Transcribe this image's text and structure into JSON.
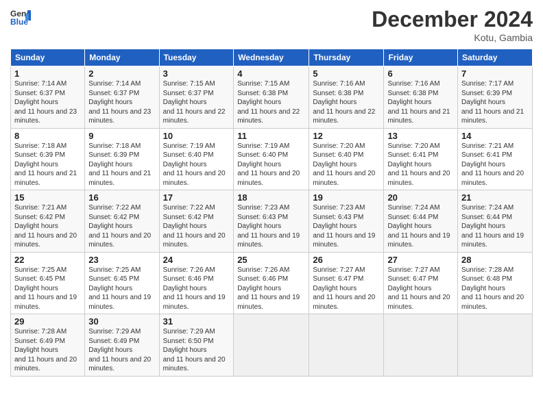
{
  "logo": {
    "general": "General",
    "blue": "Blue"
  },
  "title": "December 2024",
  "location": "Kotu, Gambia",
  "days_of_week": [
    "Sunday",
    "Monday",
    "Tuesday",
    "Wednesday",
    "Thursday",
    "Friday",
    "Saturday"
  ],
  "weeks": [
    [
      {
        "day": 1,
        "sunrise": "7:14 AM",
        "sunset": "6:37 PM",
        "daylight": "11 hours and 23 minutes."
      },
      {
        "day": 2,
        "sunrise": "7:14 AM",
        "sunset": "6:37 PM",
        "daylight": "11 hours and 23 minutes."
      },
      {
        "day": 3,
        "sunrise": "7:15 AM",
        "sunset": "6:37 PM",
        "daylight": "11 hours and 22 minutes."
      },
      {
        "day": 4,
        "sunrise": "7:15 AM",
        "sunset": "6:38 PM",
        "daylight": "11 hours and 22 minutes."
      },
      {
        "day": 5,
        "sunrise": "7:16 AM",
        "sunset": "6:38 PM",
        "daylight": "11 hours and 22 minutes."
      },
      {
        "day": 6,
        "sunrise": "7:16 AM",
        "sunset": "6:38 PM",
        "daylight": "11 hours and 21 minutes."
      },
      {
        "day": 7,
        "sunrise": "7:17 AM",
        "sunset": "6:39 PM",
        "daylight": "11 hours and 21 minutes."
      }
    ],
    [
      {
        "day": 8,
        "sunrise": "7:18 AM",
        "sunset": "6:39 PM",
        "daylight": "11 hours and 21 minutes."
      },
      {
        "day": 9,
        "sunrise": "7:18 AM",
        "sunset": "6:39 PM",
        "daylight": "11 hours and 21 minutes."
      },
      {
        "day": 10,
        "sunrise": "7:19 AM",
        "sunset": "6:40 PM",
        "daylight": "11 hours and 20 minutes."
      },
      {
        "day": 11,
        "sunrise": "7:19 AM",
        "sunset": "6:40 PM",
        "daylight": "11 hours and 20 minutes."
      },
      {
        "day": 12,
        "sunrise": "7:20 AM",
        "sunset": "6:40 PM",
        "daylight": "11 hours and 20 minutes."
      },
      {
        "day": 13,
        "sunrise": "7:20 AM",
        "sunset": "6:41 PM",
        "daylight": "11 hours and 20 minutes."
      },
      {
        "day": 14,
        "sunrise": "7:21 AM",
        "sunset": "6:41 PM",
        "daylight": "11 hours and 20 minutes."
      }
    ],
    [
      {
        "day": 15,
        "sunrise": "7:21 AM",
        "sunset": "6:42 PM",
        "daylight": "11 hours and 20 minutes."
      },
      {
        "day": 16,
        "sunrise": "7:22 AM",
        "sunset": "6:42 PM",
        "daylight": "11 hours and 20 minutes."
      },
      {
        "day": 17,
        "sunrise": "7:22 AM",
        "sunset": "6:42 PM",
        "daylight": "11 hours and 20 minutes."
      },
      {
        "day": 18,
        "sunrise": "7:23 AM",
        "sunset": "6:43 PM",
        "daylight": "11 hours and 19 minutes."
      },
      {
        "day": 19,
        "sunrise": "7:23 AM",
        "sunset": "6:43 PM",
        "daylight": "11 hours and 19 minutes."
      },
      {
        "day": 20,
        "sunrise": "7:24 AM",
        "sunset": "6:44 PM",
        "daylight": "11 hours and 19 minutes."
      },
      {
        "day": 21,
        "sunrise": "7:24 AM",
        "sunset": "6:44 PM",
        "daylight": "11 hours and 19 minutes."
      }
    ],
    [
      {
        "day": 22,
        "sunrise": "7:25 AM",
        "sunset": "6:45 PM",
        "daylight": "11 hours and 19 minutes."
      },
      {
        "day": 23,
        "sunrise": "7:25 AM",
        "sunset": "6:45 PM",
        "daylight": "11 hours and 19 minutes."
      },
      {
        "day": 24,
        "sunrise": "7:26 AM",
        "sunset": "6:46 PM",
        "daylight": "11 hours and 19 minutes."
      },
      {
        "day": 25,
        "sunrise": "7:26 AM",
        "sunset": "6:46 PM",
        "daylight": "11 hours and 19 minutes."
      },
      {
        "day": 26,
        "sunrise": "7:27 AM",
        "sunset": "6:47 PM",
        "daylight": "11 hours and 20 minutes."
      },
      {
        "day": 27,
        "sunrise": "7:27 AM",
        "sunset": "6:47 PM",
        "daylight": "11 hours and 20 minutes."
      },
      {
        "day": 28,
        "sunrise": "7:28 AM",
        "sunset": "6:48 PM",
        "daylight": "11 hours and 20 minutes."
      }
    ],
    [
      {
        "day": 29,
        "sunrise": "7:28 AM",
        "sunset": "6:49 PM",
        "daylight": "11 hours and 20 minutes."
      },
      {
        "day": 30,
        "sunrise": "7:29 AM",
        "sunset": "6:49 PM",
        "daylight": "11 hours and 20 minutes."
      },
      {
        "day": 31,
        "sunrise": "7:29 AM",
        "sunset": "6:50 PM",
        "daylight": "11 hours and 20 minutes."
      },
      null,
      null,
      null,
      null
    ]
  ]
}
